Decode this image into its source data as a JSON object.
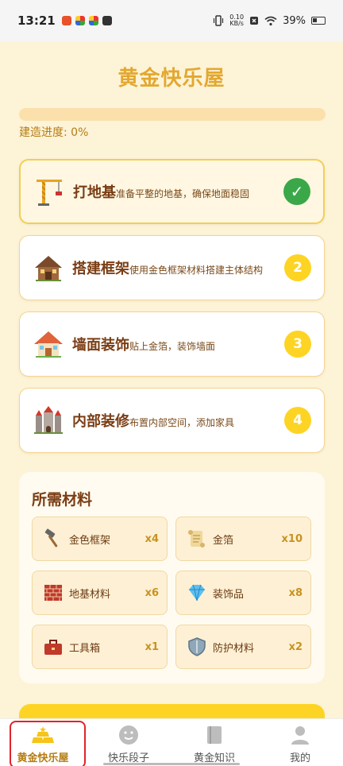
{
  "status_bar": {
    "time": "13:21",
    "net_speed_value": "0.10",
    "net_speed_unit": "KB/s",
    "battery": "39%"
  },
  "page": {
    "title": "黄金快乐屋",
    "progress_label": "建造进度: 0%",
    "progress_fraction": 0.0
  },
  "steps": [
    {
      "title": "打地基",
      "desc": "准备平整的地基，确保地面稳固",
      "badge": "✓",
      "status": "done",
      "icon": "crane-icon"
    },
    {
      "title": "搭建框架",
      "desc": "使用金色框架材料搭建主体结构",
      "badge": "2",
      "status": "pending",
      "icon": "wooden-house-icon"
    },
    {
      "title": "墙面装饰",
      "desc": "贴上金箔，装饰墙面",
      "badge": "3",
      "status": "pending",
      "icon": "house-icon"
    },
    {
      "title": "内部装修",
      "desc": "布置内部空间，添加家具",
      "badge": "4",
      "status": "pending",
      "icon": "castle-icon"
    }
  ],
  "materials": {
    "title": "所需材料",
    "items": [
      {
        "name": "金色框架",
        "qty": "x4",
        "icon": "hammer-icon"
      },
      {
        "name": "金箔",
        "qty": "x10",
        "icon": "scroll-icon"
      },
      {
        "name": "地基材料",
        "qty": "x6",
        "icon": "bricks-icon"
      },
      {
        "name": "装饰品",
        "qty": "x8",
        "icon": "gem-icon"
      },
      {
        "name": "工具箱",
        "qty": "x1",
        "icon": "toolbox-icon"
      },
      {
        "name": "防护材料",
        "qty": "x2",
        "icon": "shield-icon"
      }
    ]
  },
  "nav": [
    {
      "label": "黄金快乐屋",
      "icon": "gold-bars-icon",
      "selected": true
    },
    {
      "label": "快乐段子",
      "icon": "smile-icon",
      "selected": false
    },
    {
      "label": "黄金知识",
      "icon": "book-icon",
      "selected": false
    },
    {
      "label": "我的",
      "icon": "user-icon",
      "selected": false
    }
  ],
  "colors": {
    "accent": "#e3a830",
    "badge": "#fdd423",
    "done": "#3aa848",
    "background": "#fdf3d7"
  }
}
